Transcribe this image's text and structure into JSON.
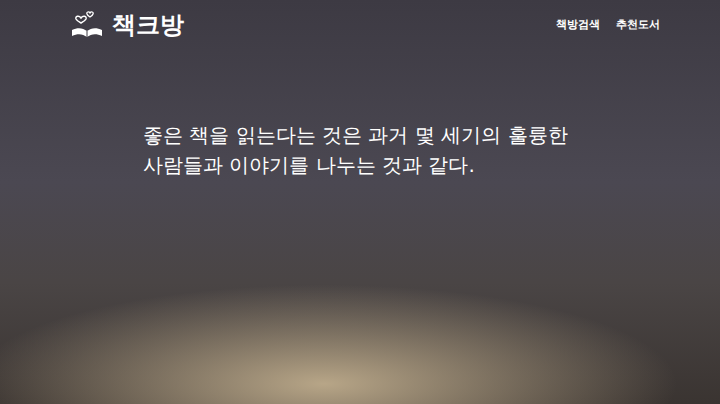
{
  "site": {
    "title": "책크방"
  },
  "nav": [
    {
      "label": "책방검색"
    },
    {
      "label": "추천도서"
    }
  ],
  "hero": {
    "quote_lines": [
      "좋은 책을 읽는다는 것은 과거 몇 세기의 훌륭한",
      "사람들과 이야기를 나누는 것과 같다."
    ]
  }
}
